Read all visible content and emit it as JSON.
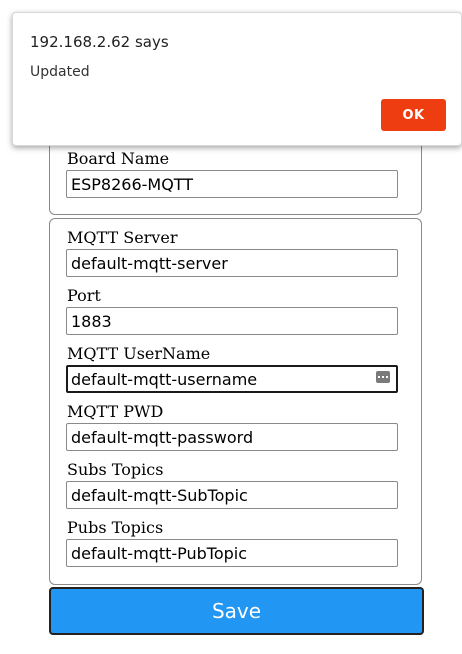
{
  "dialog": {
    "title": "192.168.2.62 says",
    "message": "Updated",
    "ok_label": "OK"
  },
  "board": {
    "label": "Board Name",
    "value": "ESP8266-MQTT"
  },
  "mqtt": {
    "server_label": "MQTT Server",
    "server_value": "default-mqtt-server",
    "port_label": "Port",
    "port_value": "1883",
    "username_label": "MQTT UserName",
    "username_value": "default-mqtt-username",
    "pwd_label": "MQTT PWD",
    "pwd_value": "default-mqtt-password",
    "subs_label": "Subs Topics",
    "subs_value": "default-mqtt-SubTopic",
    "pubs_label": "Pubs Topics",
    "pubs_value": "default-mqtt-PubTopic"
  },
  "save_label": "Save",
  "colors": {
    "save_button": "#2196f3",
    "ok_button": "#ee3d10"
  },
  "icons": {
    "username_autofill": "key-icon"
  }
}
